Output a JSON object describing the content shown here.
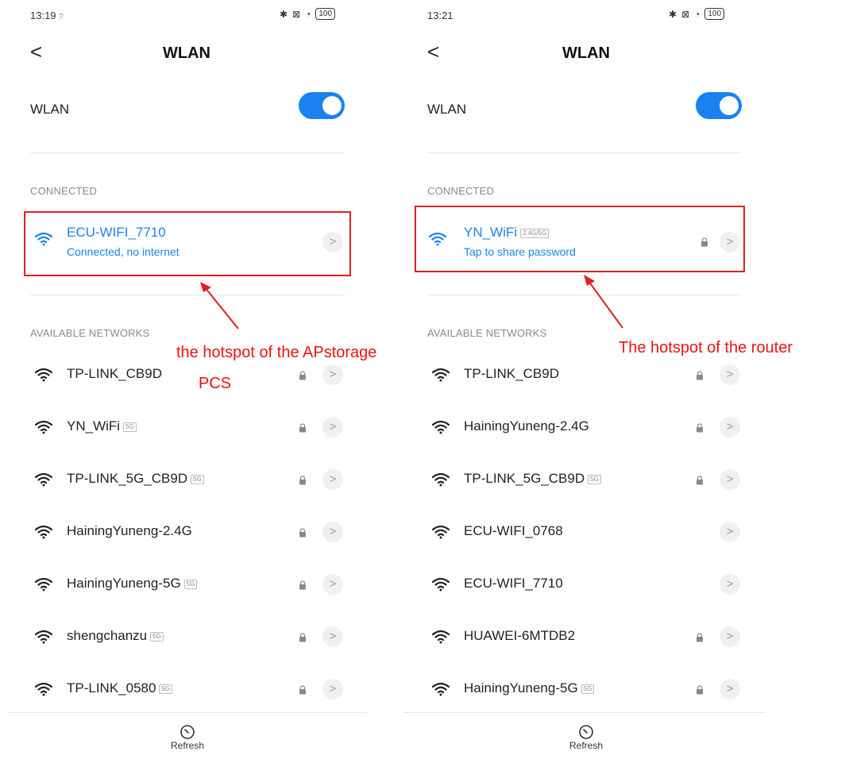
{
  "left": {
    "time": "13:19",
    "signal_mark": "?",
    "battery": "100",
    "title": "WLAN",
    "wlan_label": "WLAN",
    "connected_section": "CONNECTED",
    "connected_network": {
      "name": "ECU-WIFI_7710",
      "status": "Connected, no internet"
    },
    "available_section": "AVAILABLE NETWORKS",
    "networks": [
      {
        "name": "TP-LINK_CB9D",
        "tag": "",
        "locked": true
      },
      {
        "name": "YN_WiFi",
        "tag": "5G",
        "locked": true
      },
      {
        "name": "TP-LINK_5G_CB9D",
        "tag": "5G",
        "locked": true
      },
      {
        "name": "HainingYuneng-2.4G",
        "tag": "",
        "locked": true
      },
      {
        "name": "HainingYuneng-5G",
        "tag": "5G",
        "locked": true
      },
      {
        "name": "shengchanzu",
        "tag": "5G",
        "locked": true
      },
      {
        "name": "TP-LINK_0580",
        "tag": "5G",
        "locked": true
      }
    ],
    "refresh_label": "Refresh"
  },
  "right": {
    "time": "13:21",
    "battery": "100",
    "title": "WLAN",
    "wlan_label": "WLAN",
    "connected_section": "CONNECTED",
    "connected_network": {
      "name": "YN_WiFi",
      "tag": "2.4G/5G",
      "status": "Tap to share password"
    },
    "available_section": "AVAILABLE NETWORKS",
    "networks": [
      {
        "name": "TP-LINK_CB9D",
        "tag": "",
        "locked": true
      },
      {
        "name": "HainingYuneng-2.4G",
        "tag": "",
        "locked": true
      },
      {
        "name": "TP-LINK_5G_CB9D",
        "tag": "5G",
        "locked": true
      },
      {
        "name": "ECU-WIFI_0768",
        "tag": "",
        "locked": false
      },
      {
        "name": "ECU-WIFI_7710",
        "tag": "",
        "locked": false
      },
      {
        "name": "HUAWEI-6MTDB2",
        "tag": "",
        "locked": true
      },
      {
        "name": "HainingYuneng-5G",
        "tag": "5G",
        "locked": true
      }
    ],
    "refresh_label": "Refresh"
  },
  "annotations": {
    "left_line1": "the  hotspot  of  the  APstorage",
    "left_line2": "PCS",
    "right": "The hotspot of the router"
  },
  "colors": {
    "accent": "#1a82f0",
    "annotation": "#e02020"
  }
}
